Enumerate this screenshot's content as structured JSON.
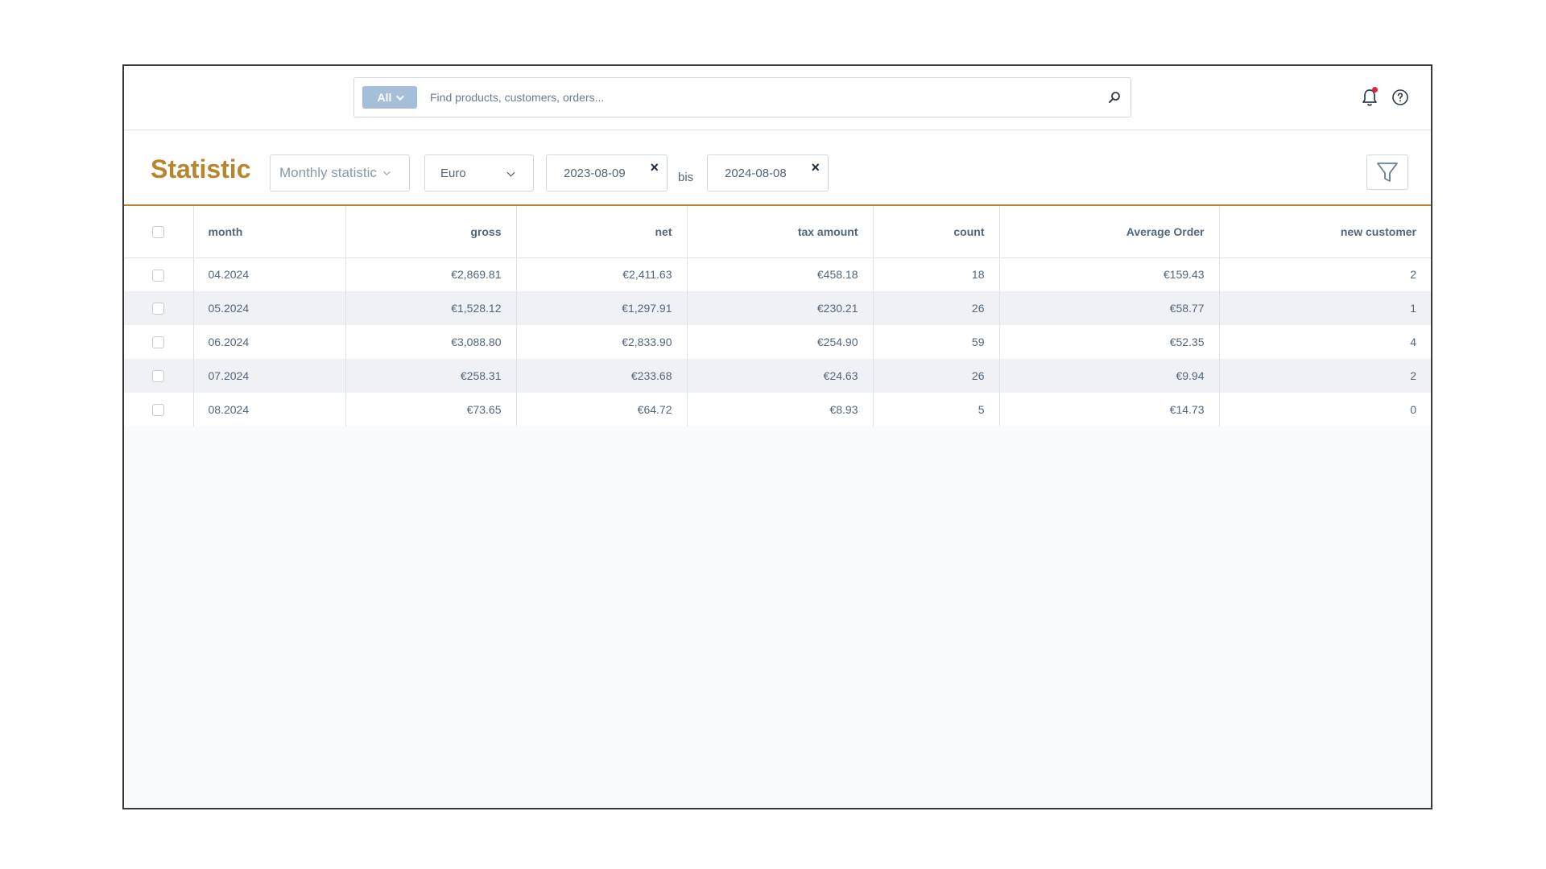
{
  "search": {
    "scope_label": "All",
    "placeholder": "Find products, customers, orders..."
  },
  "header_icons": [
    "search-icon",
    "bell-icon",
    "help-circle-icon",
    "filter-icon"
  ],
  "colors": {
    "accent": "#b7862c",
    "scope_button": "#a6bfd9",
    "notification_dot": "#e5203a",
    "row_stripe": "#eff1f4"
  },
  "toolbar": {
    "title": "Statistic",
    "statistic_type": "Monthly statistic",
    "currency": "Euro",
    "date_from": "2023-08-09",
    "date_to": "2024-08-08",
    "range_separator": "bis",
    "clear_symbol": "×"
  },
  "table": {
    "columns": [
      "month",
      "gross",
      "net",
      "tax amount",
      "count",
      "Average Order",
      "new customer"
    ],
    "rows": [
      [
        "04.2024",
        "€2,869.81",
        "€2,411.63",
        "€458.18",
        "18",
        "€159.43",
        "2"
      ],
      [
        "05.2024",
        "€1,528.12",
        "€1,297.91",
        "€230.21",
        "26",
        "€58.77",
        "1"
      ],
      [
        "06.2024",
        "€3,088.80",
        "€2,833.90",
        "€254.90",
        "59",
        "€52.35",
        "4"
      ],
      [
        "07.2024",
        "€258.31",
        "€233.68",
        "€24.63",
        "26",
        "€9.94",
        "2"
      ],
      [
        "08.2024",
        "€73.65",
        "€64.72",
        "€8.93",
        "5",
        "€14.73",
        "0"
      ]
    ]
  }
}
